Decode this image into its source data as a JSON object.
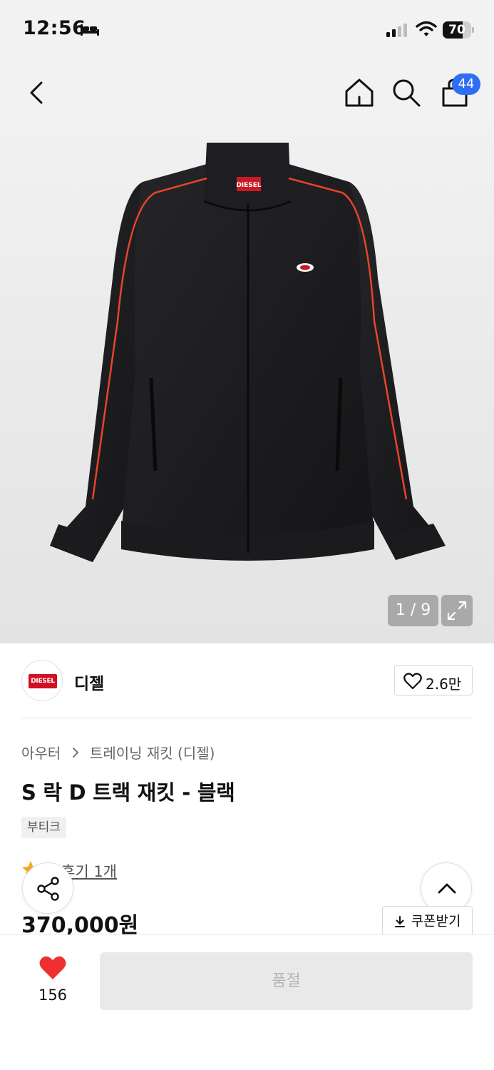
{
  "status_bar": {
    "time": "12:56",
    "battery_level": "70",
    "battery_fraction": 0.7
  },
  "nav": {
    "cart_count": "44"
  },
  "gallery": {
    "counter": "1 / 9",
    "brand_label_on_jacket": "DIESEL",
    "accent_color": "#e8442a"
  },
  "brand": {
    "logo_text": "DIESEL",
    "name": "디젤",
    "like_count": "2.6만",
    "logo_color": "#d10f23"
  },
  "breadcrumb": {
    "category": "아우터",
    "subcategory": "트레이닝 재킷 (디젤)"
  },
  "product": {
    "title": "S 락 D 트랙 재킷 - 블랙",
    "tag": "부티크",
    "review_link": "후기 1개",
    "price": "370,000원",
    "coupon_label": "쿠폰받기"
  },
  "bottom_bar": {
    "wish_count": "156",
    "buy_label": "품절",
    "heart_color": "#f03030"
  }
}
